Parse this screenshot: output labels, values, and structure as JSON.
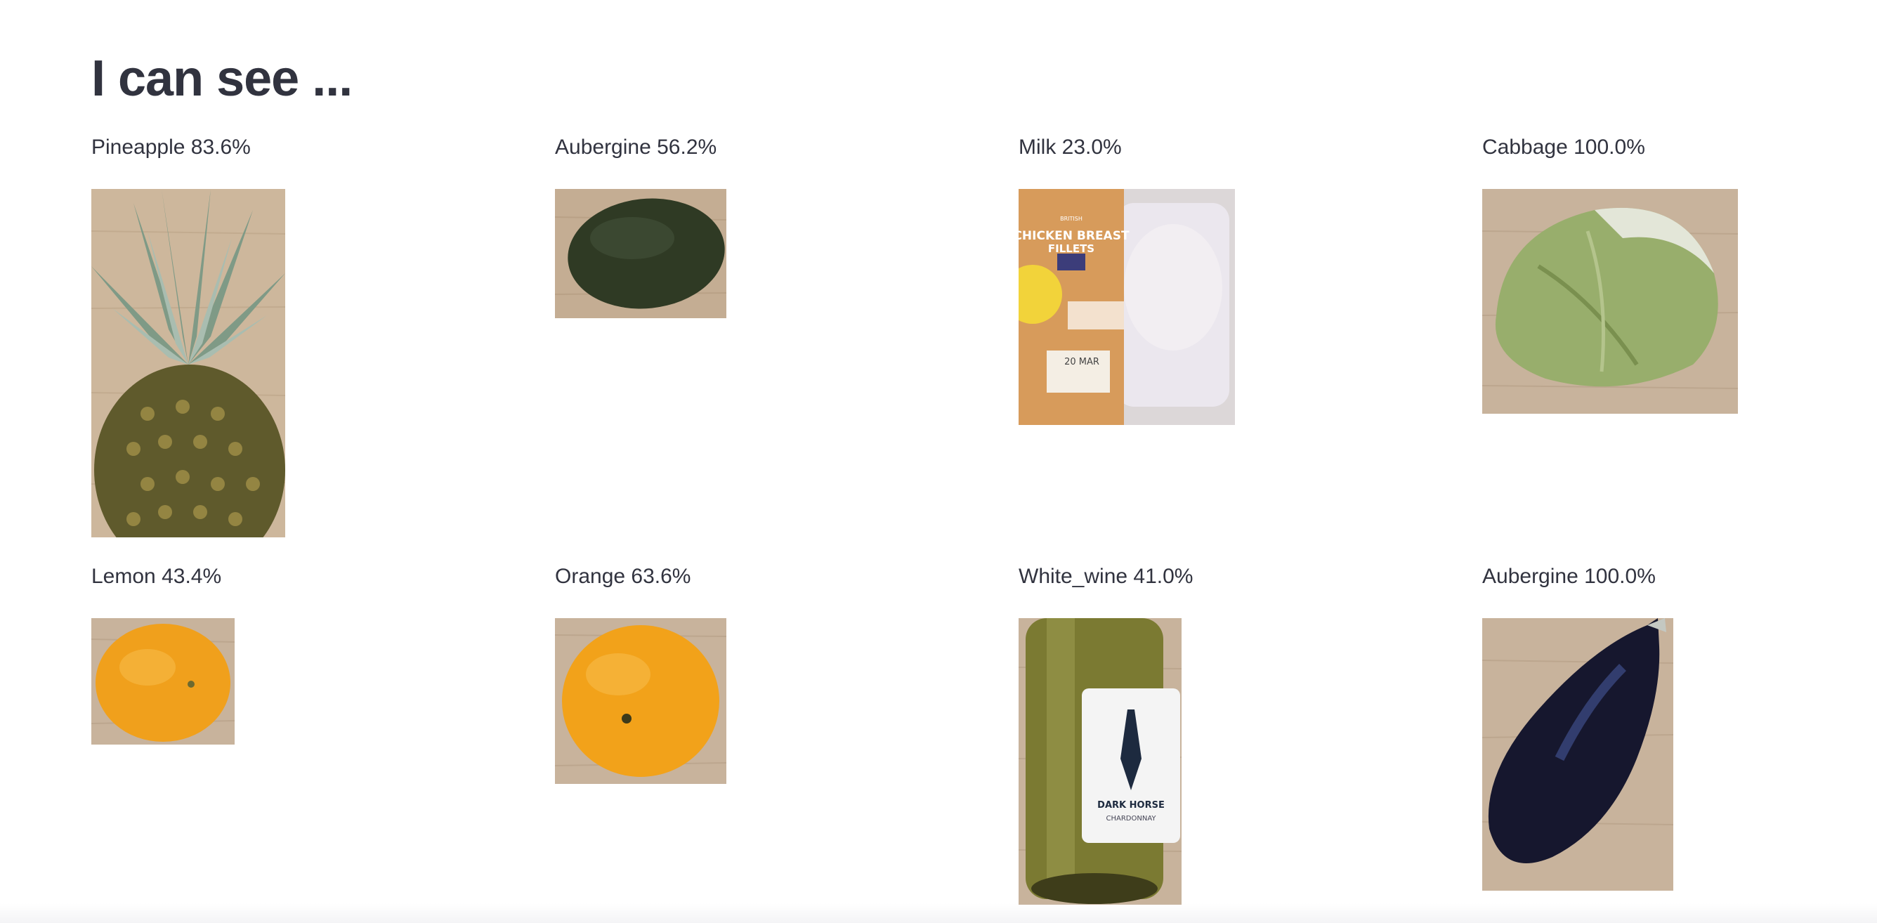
{
  "heading": "I can see ...",
  "predictions": [
    {
      "label": "Pineapple",
      "confidence": "83.6%"
    },
    {
      "label": "Aubergine",
      "confidence": "56.2%"
    },
    {
      "label": "Milk",
      "confidence": "23.0%"
    },
    {
      "label": "Cabbage",
      "confidence": "100.0%"
    },
    {
      "label": "Lemon",
      "confidence": "43.4%"
    },
    {
      "label": "Orange",
      "confidence": "63.6%"
    },
    {
      "label": "White_wine",
      "confidence": "41.0%"
    },
    {
      "label": "Aubergine",
      "confidence": "100.0%"
    }
  ],
  "package_label": {
    "brand_top": "BRITISH",
    "line1": "CHICKEN BREAST",
    "line2": "FILLETS",
    "date": "20 MAR"
  },
  "wine_label": {
    "line1": "DARK HORSE",
    "line2": "CHARDONNAY"
  },
  "colors": {
    "text": "#31333f",
    "wood": "#c9b39a",
    "citrus": "#f2a21a"
  }
}
